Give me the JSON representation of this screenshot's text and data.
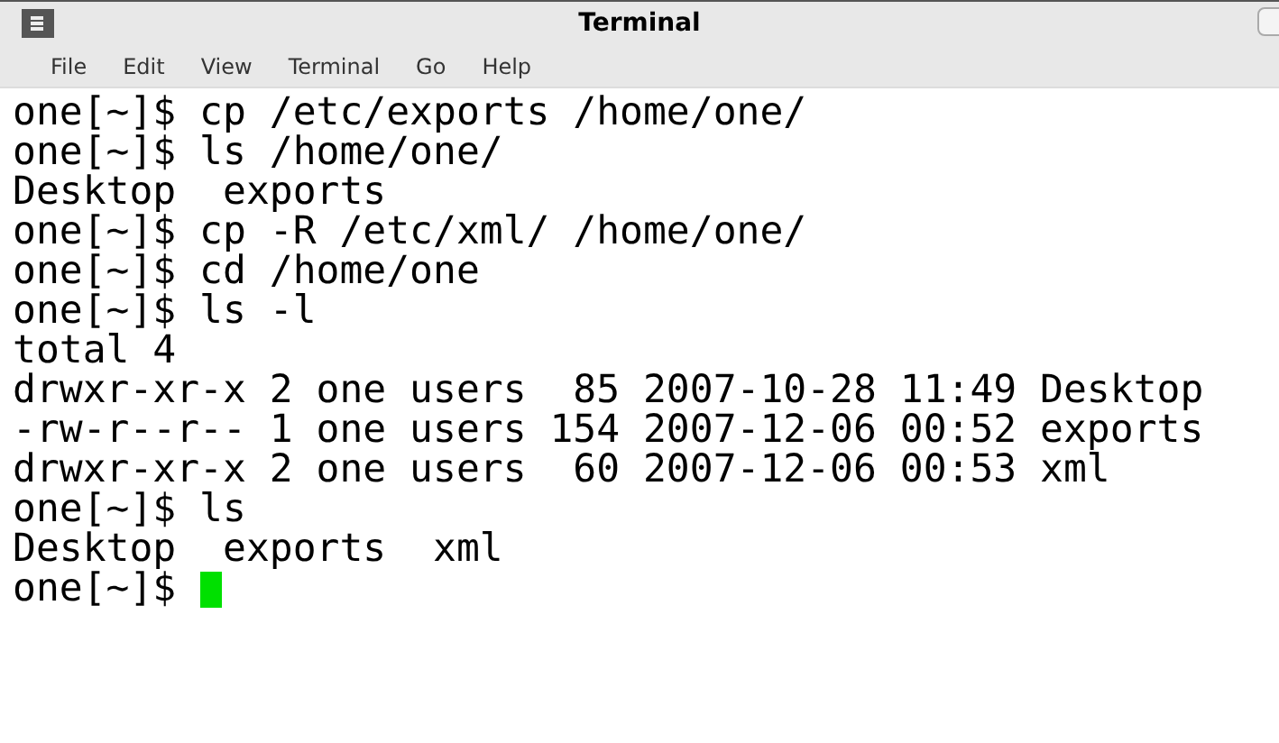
{
  "window": {
    "title": "Terminal"
  },
  "menu": [
    "File",
    "Edit",
    "View",
    "Terminal",
    "Go",
    "Help"
  ],
  "lines": [
    "one[~]$ cp /etc/exports /home/one/",
    "one[~]$ ls /home/one/",
    "Desktop  exports",
    "one[~]$ cp -R /etc/xml/ /home/one/",
    "one[~]$ cd /home/one",
    "one[~]$ ls -l",
    "total 4",
    "drwxr-xr-x 2 one users  85 2007-10-28 11:49 Desktop",
    "-rw-r--r-- 1 one users 154 2007-12-06 00:52 exports",
    "drwxr-xr-x 2 one users  60 2007-12-06 00:53 xml",
    "one[~]$ ls",
    "Desktop  exports  xml"
  ],
  "prompt": "one[~]$ "
}
